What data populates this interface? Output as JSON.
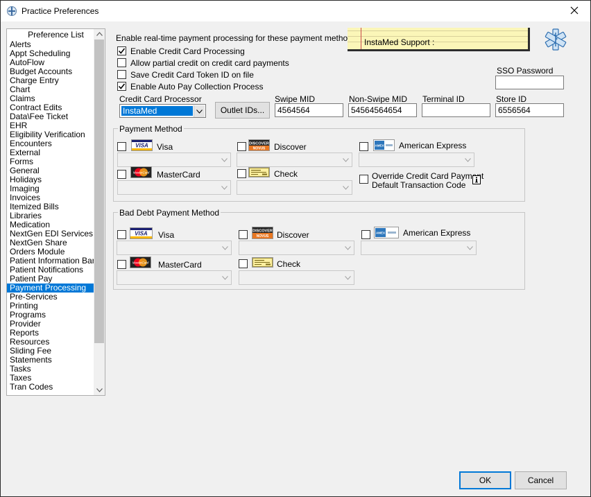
{
  "window": {
    "title": "Practice Preferences",
    "close_label": "×"
  },
  "preference_list": {
    "header": "Preference List",
    "selected": "Payment Processing",
    "items": [
      "Alerts",
      "Appt Scheduling",
      "AutoFlow",
      "Budget Accounts",
      "Charge Entry",
      "Chart",
      "Claims",
      "Contract Edits",
      "Data\\Fee Ticket",
      "EHR",
      "Eligibility Verification",
      "Encounters",
      "External",
      "Forms",
      "General",
      "Holidays",
      "Imaging",
      "Invoices",
      "Itemized Bills",
      "Libraries",
      "Medication",
      "NextGen EDI Services",
      "NextGen Share",
      "Orders Module",
      "Patient Information Bar",
      "Patient Notifications",
      "Patient Pay",
      "Payment Processing",
      "Pre-Services",
      "Printing",
      "Programs",
      "Provider",
      "Reports",
      "Resources",
      "Sliding Fee",
      "Statements",
      "Tasks",
      "Taxes",
      "Tran Codes"
    ]
  },
  "payment_processing": {
    "heading": "Enable real-time payment processing for these payment methods",
    "support_label": "InstaMed Support :",
    "options": [
      {
        "label": "Enable Credit Card Processing",
        "checked": true
      },
      {
        "label": "Allow partial credit on credit card payments",
        "checked": false
      },
      {
        "label": "Save Credit Card Token ID on file",
        "checked": false
      },
      {
        "label": "Enable Auto Pay Collection Process",
        "checked": true
      }
    ],
    "sso_password_label": "SSO Password",
    "sso_password_value": "",
    "processor_label": "Credit Card Processor",
    "processor_value": "InstaMed",
    "outlet_ids_button": "Outlet IDs...",
    "swipe_mid_label": "Swipe MID",
    "swipe_mid_value": "4564564",
    "non_swipe_mid_label": "Non-Swipe MID",
    "non_swipe_mid_value": "54564564654",
    "terminal_id_label": "Terminal ID",
    "terminal_id_value": "",
    "store_id_label": "Store ID",
    "store_id_value": "6556564"
  },
  "payment_method": {
    "title": "Payment Method",
    "visa": "Visa",
    "discover": "Discover",
    "amex": "American Express",
    "mastercard": "MasterCard",
    "check": "Check",
    "override_line1": "Override Credit Card Payment",
    "override_line2": "Default Transaction Code"
  },
  "bad_debt": {
    "title": "Bad Debt Payment Method",
    "visa": "Visa",
    "discover": "Discover",
    "amex": "American Express",
    "mastercard": "MasterCard",
    "check": "Check"
  },
  "buttons": {
    "ok": "OK",
    "cancel": "Cancel"
  },
  "colors": {
    "selection": "#0078d7",
    "support_bg": "#fbf6b8",
    "visa_blue": "#1a1f71",
    "mastercard_red": "#eb001b",
    "mastercard_orange": "#f79e1b",
    "discover_orange": "#e87722",
    "amex_blue": "#2e77bc"
  },
  "icons": {
    "title": "practice-logo-icon",
    "support": "medical-star-of-life-icon",
    "info": "info-icon"
  }
}
